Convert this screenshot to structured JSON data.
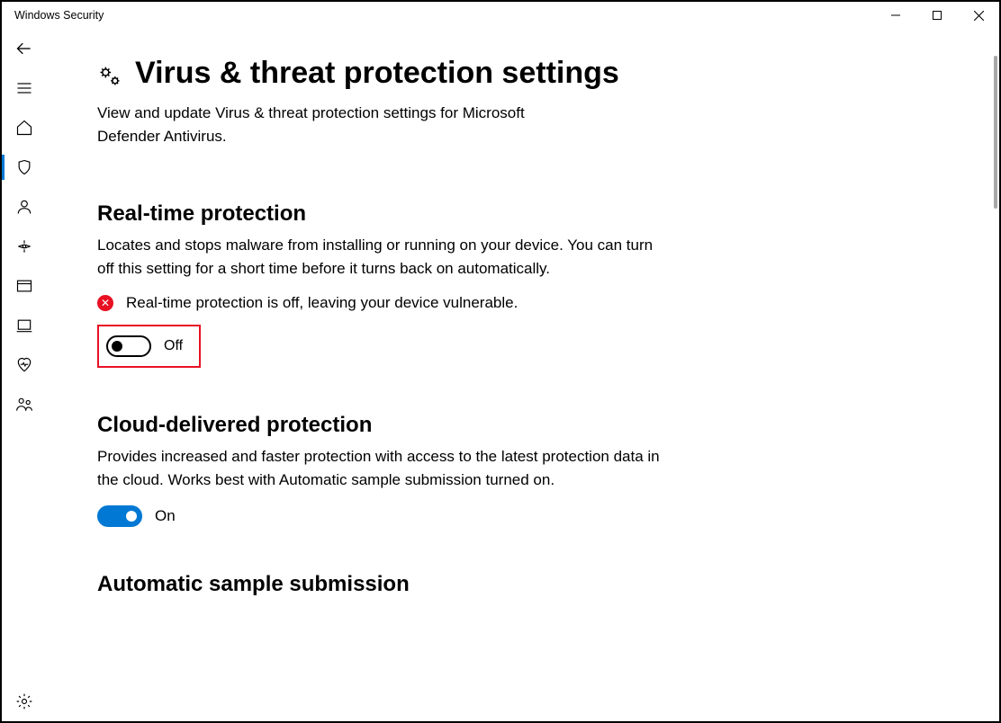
{
  "window": {
    "title": "Windows Security"
  },
  "page": {
    "title": "Virus & threat protection settings",
    "description": "View and update Virus & threat protection settings for Microsoft Defender Antivirus."
  },
  "sections": {
    "realtime": {
      "heading": "Real-time protection",
      "description": "Locates and stops malware from installing or running on your device. You can turn off this setting for a short time before it turns back on automatically.",
      "warning": "Real-time protection is off, leaving your device vulnerable.",
      "toggle_label": "Off"
    },
    "cloud": {
      "heading": "Cloud-delivered protection",
      "description": "Provides increased and faster protection with access to the latest protection data in the cloud. Works best with Automatic sample submission turned on.",
      "toggle_label": "On"
    },
    "autosample": {
      "heading": "Automatic sample submission"
    }
  }
}
